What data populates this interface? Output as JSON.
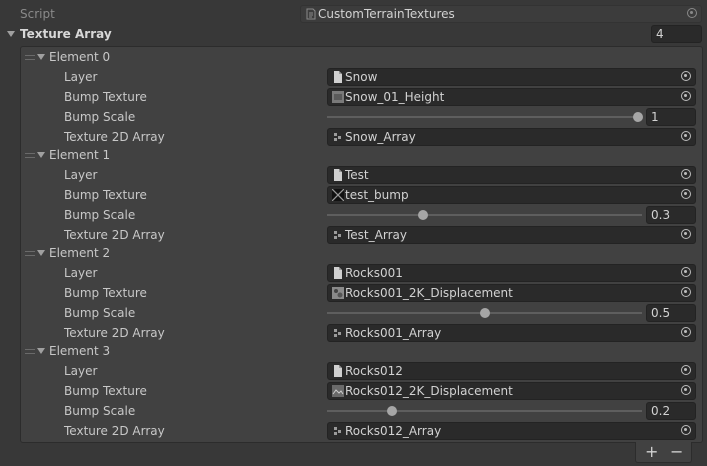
{
  "script_row": {
    "label": "Script",
    "value": "CustomTerrainTextures"
  },
  "array": {
    "label": "Texture Array",
    "size": "4"
  },
  "field_labels": {
    "layer": "Layer",
    "bump_texture": "Bump Texture",
    "bump_scale": "Bump Scale",
    "texture_2d_array": "Texture 2D Array"
  },
  "elements": [
    {
      "title": "Element 0",
      "layer": "Snow",
      "bump_texture": "Snow_01_Height",
      "bump_scale": "1",
      "bump_scale_value": 1.0,
      "texture_2d_array": "Snow_Array"
    },
    {
      "title": "Element 1",
      "layer": "Test",
      "bump_texture": "test_bump",
      "bump_scale": "0.3",
      "bump_scale_value": 0.3,
      "texture_2d_array": "Test_Array"
    },
    {
      "title": "Element 2",
      "layer": "Rocks001",
      "bump_texture": "Rocks001_2K_Displacement",
      "bump_scale": "0.5",
      "bump_scale_value": 0.5,
      "texture_2d_array": "Rocks001_Array"
    },
    {
      "title": "Element 3",
      "layer": "Rocks012",
      "bump_texture": "Rocks012_2K_Displacement",
      "bump_scale": "0.2",
      "bump_scale_value": 0.2,
      "texture_2d_array": "Rocks012_Array"
    }
  ],
  "footer": {
    "add": "+",
    "remove": "−"
  },
  "icons": {
    "layer": "document-icon",
    "bump": "texture-thumbnail-icon",
    "array": "texture-array-icon",
    "picker": "object-picker-icon"
  },
  "colors": {
    "background": "#383838",
    "field": "#2a2a2a",
    "text": "#c8c8c8"
  }
}
